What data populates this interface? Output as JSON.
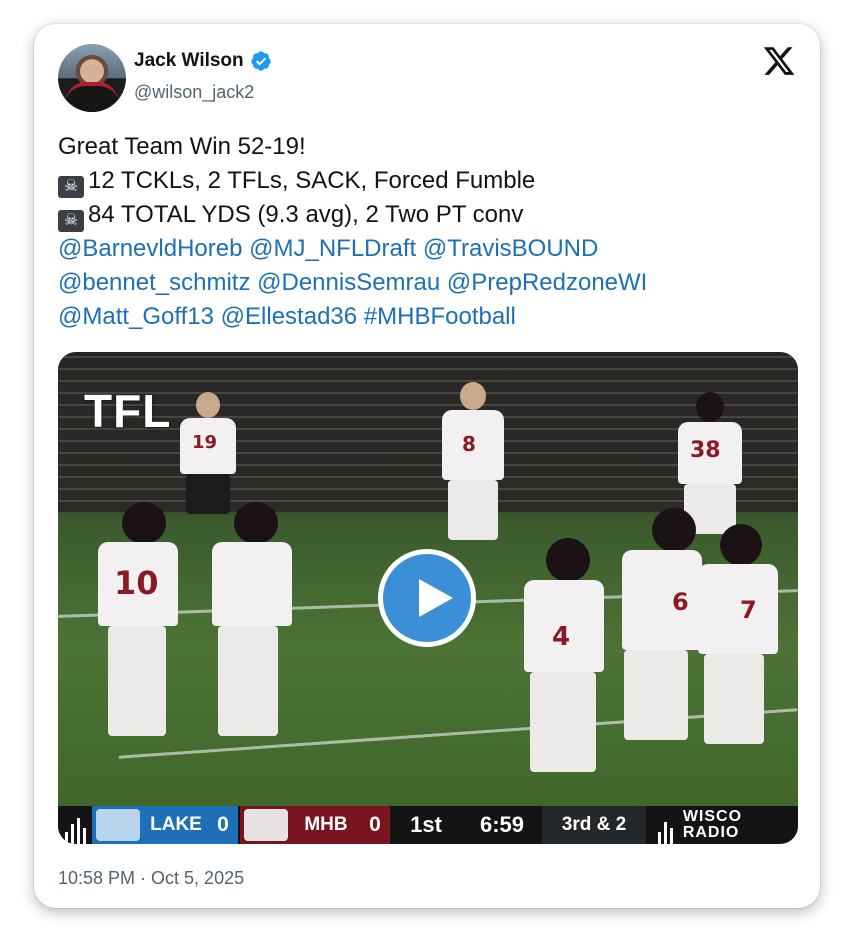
{
  "author": {
    "name": "Jack Wilson",
    "handle": "@wilson_jack2",
    "verified": true
  },
  "tweet": {
    "lines": [
      {
        "text": "Great Team Win  52-19!"
      },
      {
        "icon": "skull-and-crossbones-icon",
        "text": "12 TCKLs, 2 TFLs, SACK, Forced Fumble"
      },
      {
        "icon": "skull-and-crossbones-icon",
        "text": "84 TOTAL YDS (9.3 avg), 2 Two PT conv"
      }
    ],
    "mentions_line1": "@BarnevldHoreb @MJ_NFLDraft @TravisBOUND",
    "mentions_line2": "@bennet_schmitz @DennisSemrau @PrepRedzoneWI",
    "mentions_line3": "@Matt_Goff13 @Ellestad36 #MHBFootball"
  },
  "video": {
    "overlay_text": "TFL",
    "jersey_numbers": [
      "10",
      "19",
      "8",
      "38",
      "4",
      "6",
      "7"
    ],
    "scorebug": {
      "team1_name": "LAKE",
      "team1_score": "0",
      "team2_name": "MHB",
      "team2_score": "0",
      "period": "1st",
      "clock": "6:59",
      "down": "3rd & 2",
      "brand": "WISCO RADIO"
    }
  },
  "timestamp": "10:58 PM · Oct 5, 2025",
  "colors": {
    "link": "#1d6fb6",
    "play_button": "#3b8fd6",
    "verified": "#1d9bf0",
    "team1": "#1d6fb6",
    "team2": "#7a1520"
  }
}
